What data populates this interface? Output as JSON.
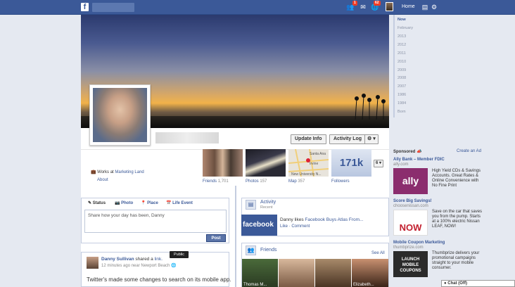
{
  "topbar": {
    "logo": "f",
    "home_label": "Home",
    "notif_counts": {
      "friends": "1",
      "messages": "",
      "notifications": "62"
    },
    "icons": [
      "friend-requests-icon",
      "messages-icon",
      "notifications-icon",
      "privacy-icon",
      "settings-icon"
    ]
  },
  "profile": {
    "update_info_label": "Update Info",
    "activity_log_label": "Activity Log",
    "settings_menu_label": "⚙ ▾",
    "works_prefix": "Works at",
    "works_link": "Marketing Land",
    "about_label": "About"
  },
  "tabs": [
    {
      "label": "Friends",
      "count": "1,701"
    },
    {
      "label": "Photos",
      "count": "157"
    },
    {
      "label": "Map",
      "count": "357"
    },
    {
      "label": "Followers",
      "count": ""
    }
  ],
  "followers_count": "171k",
  "more_tabs_count": "6 ▾",
  "map_labels": {
    "label_1": "Santa Ana",
    "label_2": "Irvine",
    "label_3": "New University N..."
  },
  "jump_nav": [
    "Now",
    "February",
    "2013",
    "2012",
    "2011",
    "2010",
    "2009",
    "2008",
    "2007",
    "1986",
    "1984",
    "Born"
  ],
  "sponsored": {
    "heading": "Sponsored",
    "create_ad": "Create an Ad",
    "ads": [
      {
        "title": "Ally Bank – Member FDIC",
        "domain": "ally.com",
        "text": "High Yield CDs & Savings Accounts. Great Rates & Online Convenience with No Fine Print",
        "img_label": "ally",
        "color": "#8b2d6e"
      },
      {
        "title": "Score Big Savings!",
        "domain": "choosenissan.com",
        "text": "Save on the car that saves you from the pump. Starts at a 100% electric Nissan LEAF, NOW!",
        "img_label": "NOW",
        "color": "#c21f2e"
      },
      {
        "title": "Mobile Coupon Marketing",
        "domain": "thumbprize.com",
        "text": "Thumbprize delivers your promotional campaigns straight to your mobile consumer.",
        "img_label": "LAUNCH MOBILE COUPONS",
        "color": "#2b2b2b"
      }
    ]
  },
  "composer": {
    "tabs": [
      "Status",
      "Photo",
      "Place",
      "Life Event"
    ],
    "placeholder": "Share how your day has been, Danny",
    "post_label": "Post"
  },
  "story": {
    "author": "Danny Sullivan",
    "action": "shared a",
    "link_word": "link.",
    "meta": "12 minutes ago near Newport Beach",
    "tooltip": "Public",
    "text": "Twitter's made some changes to search on its mobile app."
  },
  "activity": {
    "title": "Activity",
    "subtitle": "Recent",
    "item_prefix": "Danny likes",
    "item_link": "Facebook Buys Atlas From...",
    "actions": "Like · Comment",
    "page_logo": "facebook"
  },
  "friends_box": {
    "title": "Friends",
    "see_all": "See All",
    "names": [
      "Thomas M...",
      "",
      "",
      "Elizabeth..."
    ]
  },
  "chat": {
    "label": "Chat (Off)"
  }
}
